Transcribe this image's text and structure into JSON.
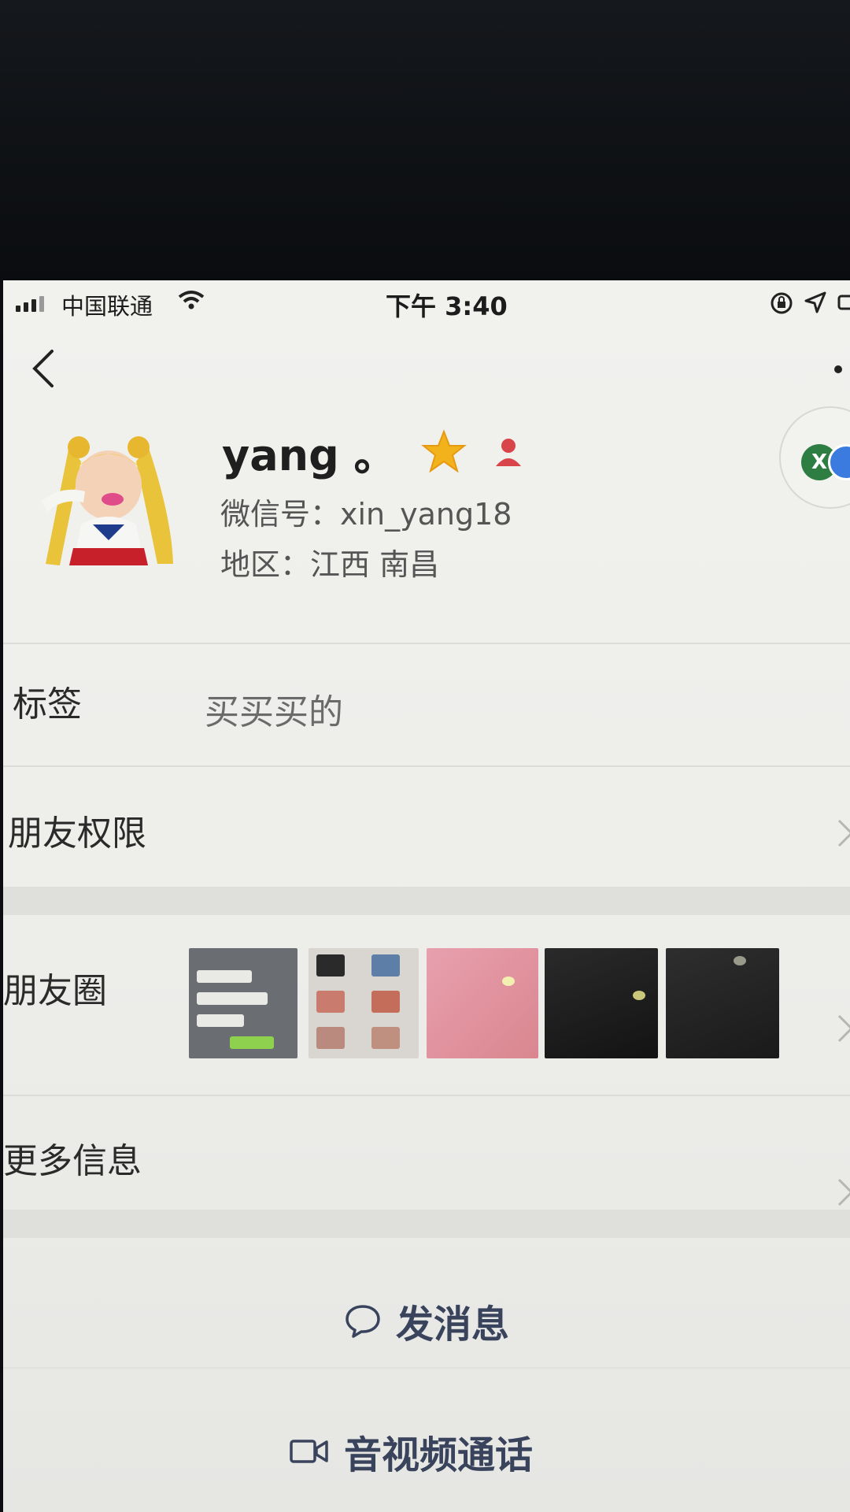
{
  "status_bar": {
    "carrier": "中国联通",
    "time": "下午 3:40"
  },
  "profile": {
    "name": "yang 。",
    "wechat_id": "微信号：xin_yang18",
    "region": "地区：江西 南昌"
  },
  "rows": {
    "tags_label": "标签",
    "tags_value": "买买买的",
    "permissions_label": "朋友权限",
    "moments_label": "朋友圈",
    "more_info_label": "更多信息"
  },
  "actions": {
    "send_message": "发消息",
    "av_call": "音视频通话"
  },
  "colors": {
    "accent_text": "#39435c",
    "badge_green": "#2e7d43",
    "badge_blue": "#3b7be0",
    "star": "#f2b21c",
    "person_icon": "#d9434a"
  }
}
